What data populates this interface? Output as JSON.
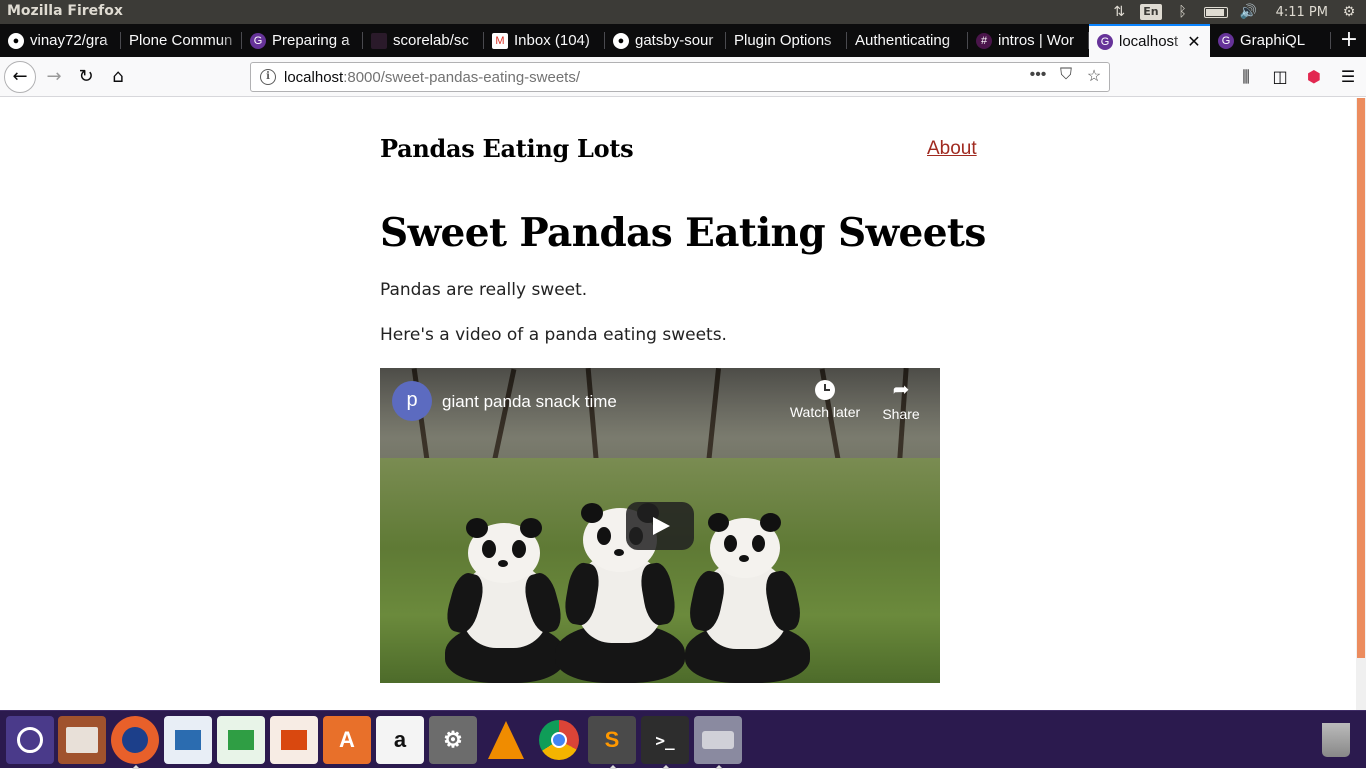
{
  "os": {
    "window_title": "Mozilla Firefox",
    "language": "En",
    "time": "4:11 PM"
  },
  "tabs": [
    {
      "label": "vinay72/gra",
      "icon": "github-icon"
    },
    {
      "label": "Plone Commun",
      "icon": "none"
    },
    {
      "label": "Preparing a",
      "icon": "gatsby-icon"
    },
    {
      "label": "scorelab/sc",
      "icon": "scorelab-icon"
    },
    {
      "label": "Inbox (104)",
      "icon": "gmail-icon"
    },
    {
      "label": "gatsby-sour",
      "icon": "github-icon"
    },
    {
      "label": "Plugin Options",
      "icon": "none"
    },
    {
      "label": "Authenticating",
      "icon": "none"
    },
    {
      "label": "intros | Wor",
      "icon": "slack-icon"
    },
    {
      "label": "localhost",
      "icon": "gatsby-icon",
      "active": true
    },
    {
      "label": "GraphiQL",
      "icon": "gatsby-icon"
    }
  ],
  "navbar": {
    "url_host": "localhost",
    "url_rest": ":8000/sweet-pandas-eating-sweets/"
  },
  "page": {
    "site_title": "Pandas Eating Lots",
    "nav_about": "About",
    "post_title": "Sweet Pandas Eating Sweets",
    "paragraph1": "Pandas are really sweet.",
    "paragraph2": "Here's a video of a panda eating sweets.",
    "video": {
      "channel_initial": "p",
      "title": "giant panda snack time",
      "watch_later": "Watch later",
      "share": "Share"
    }
  },
  "colors": {
    "link": "#a02a20",
    "scroll_accent": "#ec8c5e",
    "dock_bg": "#2b1a4e",
    "tab_active_accent": "#0a84ff"
  },
  "dock": [
    {
      "name": "ubuntu-launcher-icon"
    },
    {
      "name": "files-icon"
    },
    {
      "name": "firefox-icon",
      "running": true
    },
    {
      "name": "writer-icon"
    },
    {
      "name": "calc-icon"
    },
    {
      "name": "impress-icon"
    },
    {
      "name": "software-center-icon"
    },
    {
      "name": "amazon-icon"
    },
    {
      "name": "system-settings-icon"
    },
    {
      "name": "vlc-icon"
    },
    {
      "name": "chrome-icon"
    },
    {
      "name": "sublime-text-icon",
      "running": true
    },
    {
      "name": "terminal-icon",
      "running": true
    },
    {
      "name": "drive-icon",
      "running": true
    },
    {
      "name": "trash-icon"
    }
  ]
}
